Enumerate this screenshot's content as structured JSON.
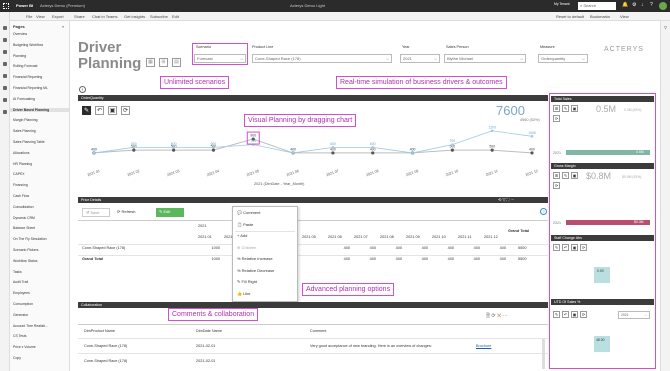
{
  "window": {
    "app": "Power BI",
    "file": "Acterys Demo (Premium)",
    "center_title": "Acterys Demo Light",
    "user": "My Tenant",
    "search": "Search"
  },
  "menu": {
    "file": "File",
    "view": "View",
    "export": "Export",
    "share": "Share",
    "chat": "Chat in Teams",
    "insights": "Get insights",
    "subscribe": "Subscribe",
    "edit": "Edit",
    "reset": "Reset to default",
    "bookmarks": "Bookmarks",
    "view_btn": "View"
  },
  "pages": {
    "title": "Pages",
    "items": [
      "Overview",
      "Budgeting Workflow",
      "Planning",
      "Rolling Forecast",
      "Financial Reporting",
      "Financial Reporting ML",
      "AI Forecasting",
      "Driver Based Planning",
      "Margin Planning",
      "Sales Planning",
      "Sales Planning Table",
      "Allocations",
      "HR Planning",
      "CAPEX",
      "Financing",
      "Cash Flow",
      "Consolidation",
      "Dynamic CRM",
      "Balance Sheet",
      "On The Fly Simulation",
      "Scenario Pickers",
      "Workflow Status",
      "Tasks",
      "Audit Trail",
      "Employees",
      "Consumption",
      "Generator",
      "Account Tree Realisti...",
      "CS Tests",
      "Price x Volume",
      "Copy"
    ],
    "selected": 7
  },
  "header": {
    "title_line1": "Driver",
    "title_line2": "Planning",
    "logo": "ACTERYS"
  },
  "filters": {
    "scenario_label": "Scenario",
    "scenario_value": "Forecast",
    "product_label": "Product Line",
    "product_value": "Cone-Shaped Race (178)",
    "year_label": "Year",
    "year_value": "2021",
    "salesperson_label": "Sales Person",
    "salesperson_value": "Blythe Michael",
    "measure_label": "Measure",
    "measure_value": "Orderquantity"
  },
  "callouts": {
    "scenarios": "Unlimited scenarios",
    "realtime": "Real-time simulation of business drivers & outcomes",
    "visual": "Visual Planning by dragging chart",
    "advanced": "Advanced planning options",
    "comments": "Comments & collaboration"
  },
  "order_chart": {
    "header": "OrderQuantity",
    "total": "7600",
    "total_sub": "4960 (53%)",
    "axis_title": "2021 (DimDate - Year_Month)"
  },
  "chart_data": {
    "type": "line",
    "x": [
      "2021 01",
      "2021 02",
      "2021 03",
      "2021 04",
      "2021 05",
      "2021 06",
      "2021 07",
      "2021 08",
      "2021 09",
      "2021 10",
      "2021 11",
      "2021 12"
    ],
    "series": [
      {
        "values": [
          400,
          500,
          500,
          500,
          900,
          400,
          400,
          400,
          400,
          500,
          500,
          400
        ]
      },
      {
        "values": [
          400,
          600,
          600,
          600,
          700,
          400,
          600,
          600,
          400,
          700,
          1200,
          1000
        ]
      }
    ]
  },
  "price_details": {
    "header": "Price Details",
    "save": "Save",
    "refresh": "Refresh",
    "edit": "Edit",
    "year": "2021",
    "grand_total": "Grand Total",
    "months": [
      "2021 01",
      "2021 02",
      "2021 03",
      "2021 04",
      "2021 05",
      "2021 06",
      "2021 07",
      "2021 08",
      "2021 09",
      "2021 10",
      "2021 11",
      "2021 12"
    ],
    "rows": [
      {
        "name": "Cone-Shaped Race (178)",
        "values": [
          "1000",
          "500",
          "400",
          "",
          "",
          "400",
          "400",
          "400",
          "400",
          "400",
          "400",
          "400"
        ],
        "total": "5500"
      },
      {
        "name": "Grand Total",
        "values": [
          "1000",
          "500",
          "400",
          "",
          "",
          "400",
          "400",
          "400",
          "400",
          "400",
          "400",
          "400"
        ],
        "total": "5500"
      }
    ]
  },
  "context_menu": {
    "items": [
      "Comment",
      "Paste",
      "Add",
      "Children",
      "Relative Increase",
      "Relative Decrease",
      "Fill Right",
      "Like"
    ]
  },
  "collab": {
    "header": "Collaboration",
    "col_product": "DimProduct Name",
    "col_date": "DimDate Name",
    "col_comment": "Comment",
    "rows": [
      {
        "product": "Cone-Shaped Race (178)",
        "date": "2021-02-01",
        "comment": "Very good acceptance of new branding. Here is an overview of changes:",
        "link": "Brochure"
      },
      {
        "product": "Cone-Shaped Race (178)",
        "date": "2021-02-01",
        "comment": "",
        "link": ""
      }
    ]
  },
  "side": {
    "total_sales": "Total Sales",
    "sales_value": "0.5M",
    "sales_sub": "0.3M (53%)",
    "sales_year": "2021",
    "sales_bar": "0.5M",
    "gross_margin": "Gross Margin",
    "gm_value": "$0.8M",
    "gm_sub": "$0.5M (53%)",
    "gm_year": "2021",
    "gm_bar": "$0.3M",
    "staff_change": "Staff Change Abs",
    "staff_val": "0.00",
    "utd": "UTD Of Sales %",
    "utd_val": "48.00",
    "utd_year": "2021"
  }
}
